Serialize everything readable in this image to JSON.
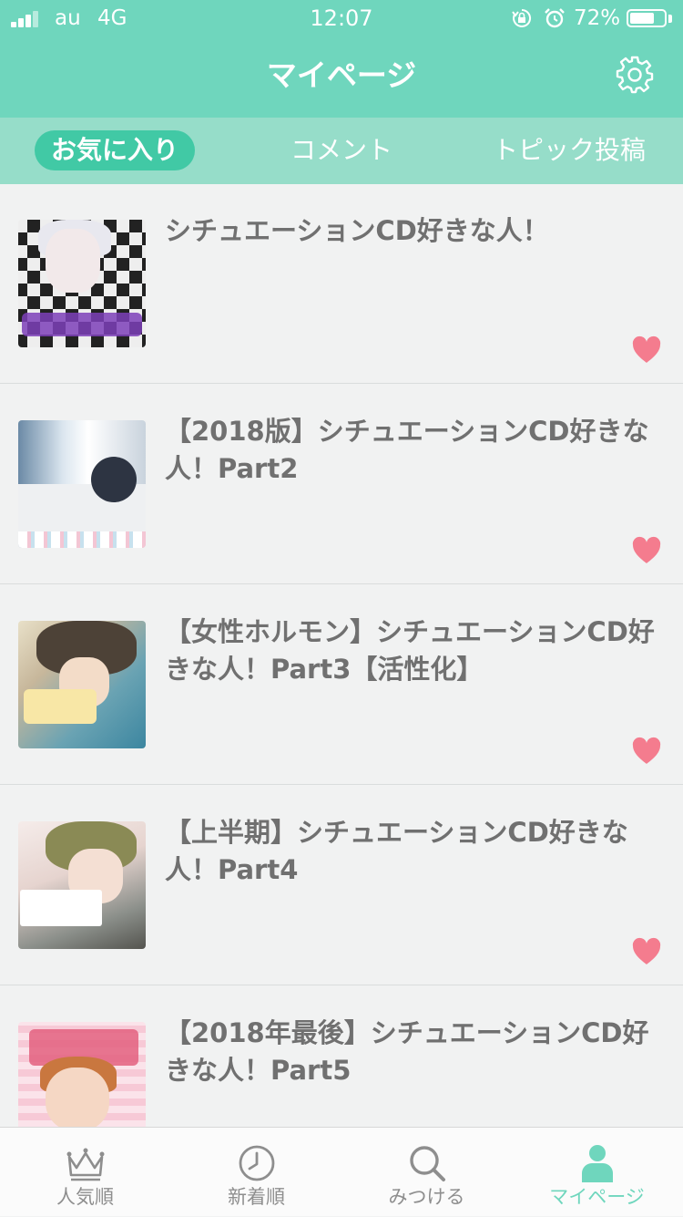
{
  "status_bar": {
    "carrier": "au",
    "network": "4G",
    "time": "12:07",
    "battery_percent": "72%",
    "battery_level": 0.72,
    "icons": [
      "signal-icon",
      "orientation-lock-icon",
      "alarm-icon",
      "battery-icon"
    ]
  },
  "header": {
    "title": "マイページ",
    "settings_icon": "gear-icon"
  },
  "tabs": [
    {
      "label": "お気に入り",
      "active": true
    },
    {
      "label": "コメント",
      "active": false
    },
    {
      "label": "トピック投稿",
      "active": false
    }
  ],
  "topics": [
    {
      "title": "シチュエーションCD好きな人！",
      "favorited": true
    },
    {
      "title": "【2018版】シチュエーションCD好きな人！Part2",
      "favorited": true
    },
    {
      "title": "【女性ホルモン】シチュエーションCD好きな人！Part3【活性化】",
      "favorited": true
    },
    {
      "title": "【上半期】シチュエーションCD好きな人！Part4",
      "favorited": true
    },
    {
      "title": "【2018年最後】シチュエーションCD好きな人！Part5",
      "favorited": true
    }
  ],
  "bottom_nav": [
    {
      "label": "人気順",
      "icon": "crown-icon",
      "active": false
    },
    {
      "label": "新着順",
      "icon": "clock-icon",
      "active": false
    },
    {
      "label": "みつける",
      "icon": "search-icon",
      "active": false
    },
    {
      "label": "マイページ",
      "icon": "person-icon",
      "active": true
    }
  ],
  "colors": {
    "accent": "#6fd6bd",
    "tab_bar": "#96ddc9",
    "active_tab": "#41c9a5",
    "heart": "#f47c8e",
    "title_text": "#707070"
  }
}
